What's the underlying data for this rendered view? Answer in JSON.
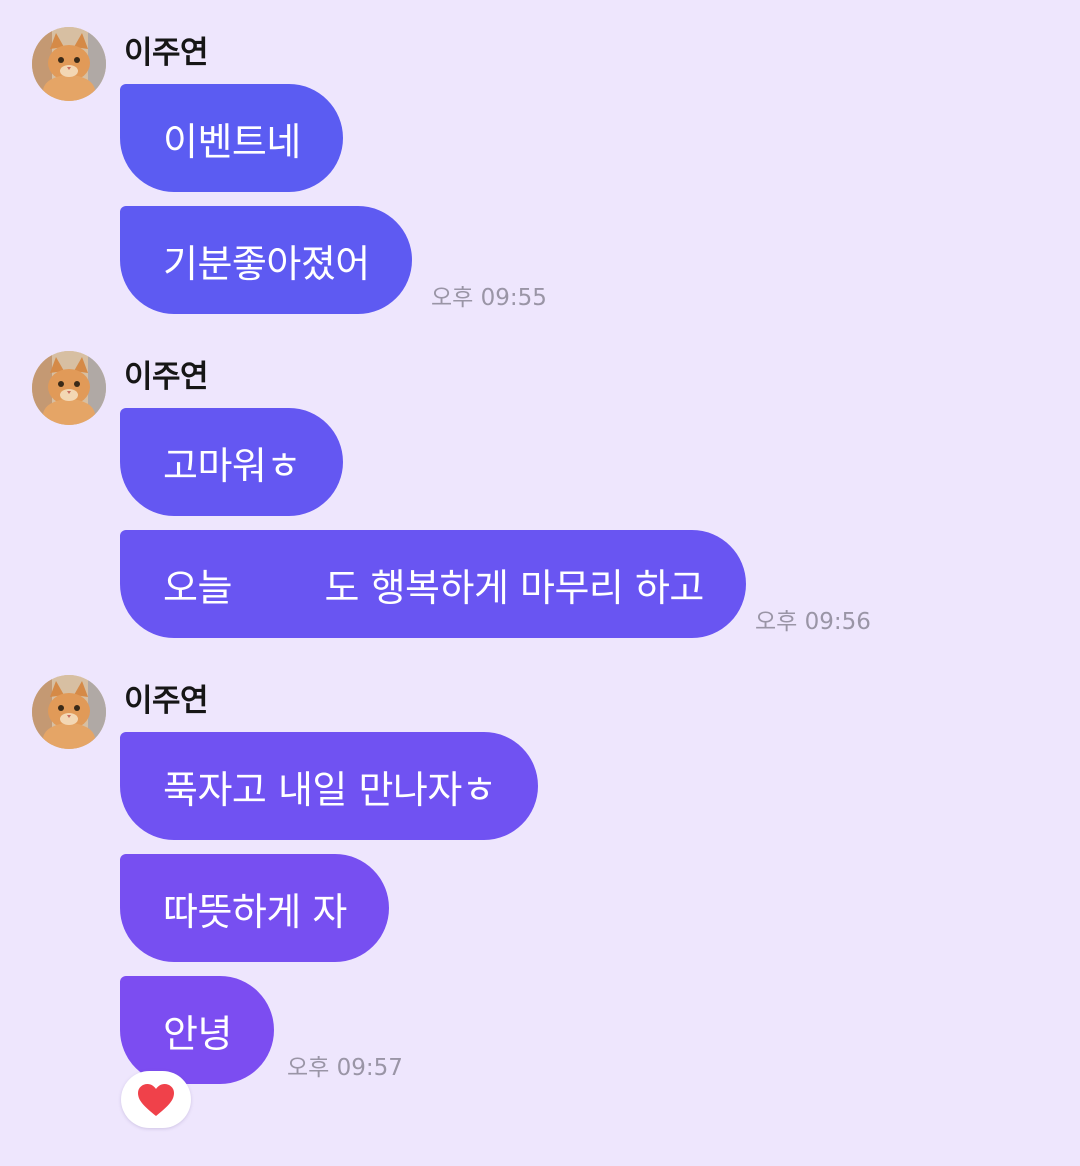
{
  "colors": {
    "background": "#eee6fd",
    "bubble_gradient_top": "#5a5cf2",
    "bubble_gradient_bottom": "#7e4cf1",
    "timestamp": "#9a95a6",
    "heart": "#f0414a"
  },
  "groups": [
    {
      "sender": "이주연",
      "avatar_icon": "cat-avatar-icon",
      "messages": [
        "이벤트네",
        "기분좋아졌어"
      ],
      "time": "오후 09:55"
    },
    {
      "sender": "이주연",
      "avatar_icon": "cat-avatar-icon",
      "messages": [
        "고마워ㅎ",
        "오늘        도 행복하게 마무리 하고"
      ],
      "time": "오후 09:56"
    },
    {
      "sender": "이주연",
      "avatar_icon": "cat-avatar-icon",
      "messages": [
        "푹자고 내일 만나자ㅎ",
        "따뜻하게 자",
        "안녕"
      ],
      "time": "오후 09:57",
      "reaction_icon": "heart-icon"
    }
  ]
}
